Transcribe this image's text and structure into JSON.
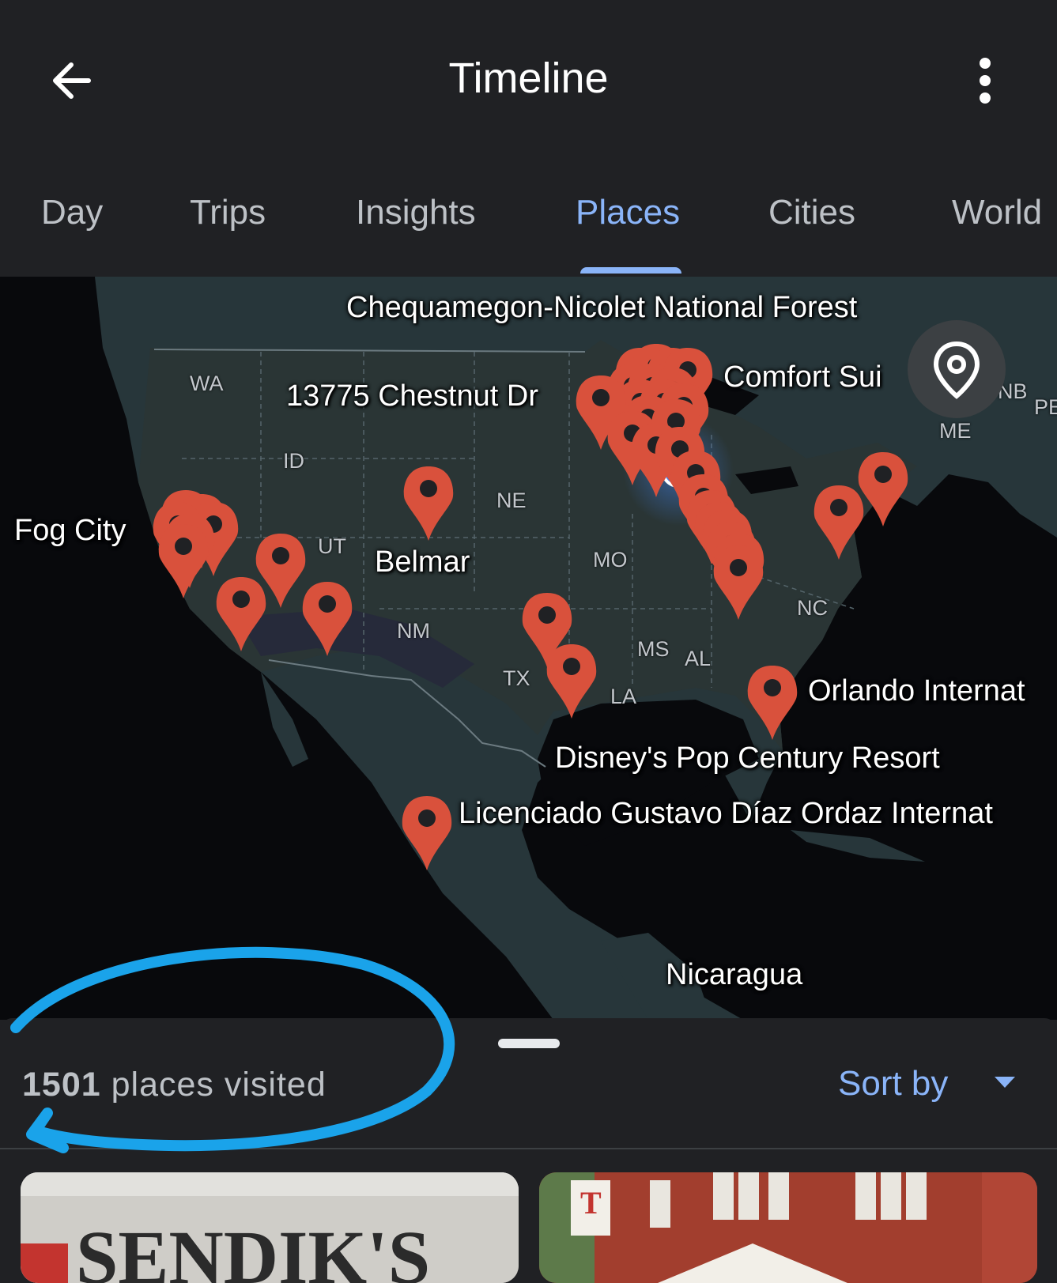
{
  "header": {
    "title": "Timeline",
    "back_icon": "arrow-left-icon",
    "more_icon": "more-vert-icon"
  },
  "tabs": [
    {
      "label": "Day",
      "active": false
    },
    {
      "label": "Trips",
      "active": false
    },
    {
      "label": "Insights",
      "active": false
    },
    {
      "label": "Places",
      "active": true
    },
    {
      "label": "Cities",
      "active": false
    },
    {
      "label": "World",
      "active": false
    }
  ],
  "map": {
    "place_labels": {
      "chequamegon": "Chequamegon-Nicolet National Forest",
      "chestnut": "13775 Chestnut Dr",
      "comfort": "Comfort Sui",
      "fog_city": "Fog City",
      "belmar": "Belmar",
      "orlando": "Orlando Internat",
      "disney": "Disney's Pop Century Resort",
      "licenciado": "Licenciado Gustavo Díaz Ordaz Internat",
      "nicaragua": "Nicaragua"
    },
    "state_labels": {
      "wa": "WA",
      "id": "ID",
      "ut": "UT",
      "ne": "NE",
      "mo": "MO",
      "nm": "NM",
      "tx": "TX",
      "ms": "MS",
      "al": "AL",
      "la": "LA",
      "nc": "NC",
      "me": "ME",
      "nb": "NB",
      "pe": "PE"
    },
    "marker_color": "#d9513c",
    "current_location_color": "#4285f4",
    "my_location_icon": "map-pin-outline-icon"
  },
  "sheet": {
    "count": "1501",
    "count_suffix": "places visited",
    "sort_label": "Sort by",
    "sort_icon": "dropdown-arrow-icon"
  },
  "cards": [
    {
      "sign_text": "SENDIK'S"
    },
    {
      "sign_text": "T"
    }
  ],
  "colors": {
    "background": "#202124",
    "accent": "#8ab4f8",
    "annotation": "#1aa3ea"
  }
}
